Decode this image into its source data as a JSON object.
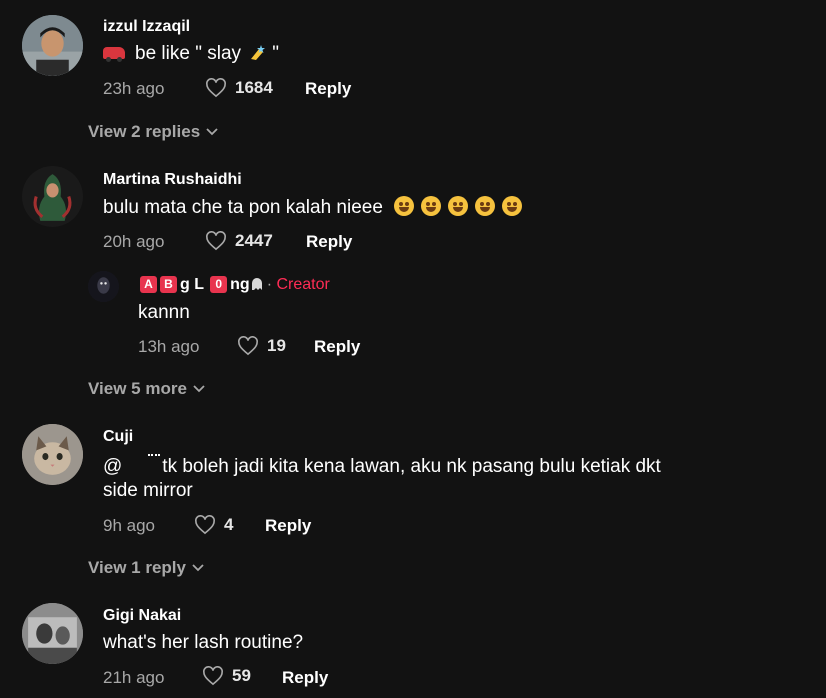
{
  "comments": [
    {
      "author": "izzul Izzaqil",
      "text": "be like \" slay",
      "text_suffix": "\"",
      "time": "23h ago",
      "likes": "1684",
      "reply": "Reply",
      "view_replies": "View 2 replies"
    },
    {
      "author": "Martina Rushaidhi",
      "text": "bulu mata che ta pon kalah nieee",
      "time": "20h ago",
      "likes": "2447",
      "reply": "Reply",
      "emoji_count": 5,
      "reply_comment": {
        "author_badges": [
          "A",
          "B"
        ],
        "author_mid": "g L",
        "author_badge2": "0",
        "author_tail": "ng",
        "separator": "·",
        "creator_label": "Creator",
        "text": "kannn",
        "time": "13h ago",
        "likes": "19",
        "reply": "Reply"
      },
      "view_more": "View 5 more"
    },
    {
      "author": "Cuji",
      "mention": "@",
      "text_line1": "tk boleh jadi kita kena lawan, aku nk pasang bulu ketiak dkt",
      "text_line2": "side mirror",
      "time": "9h ago",
      "likes": "4",
      "reply": "Reply",
      "view_replies": "View 1 reply"
    },
    {
      "author": "Gigi Nakai",
      "text": "what's her lash routine?",
      "time": "21h ago",
      "likes": "59",
      "reply": "Reply"
    }
  ],
  "colors": {
    "background": "#121212",
    "secondary_text": "#a8a8a8",
    "creator_accent": "#fe2c55"
  }
}
